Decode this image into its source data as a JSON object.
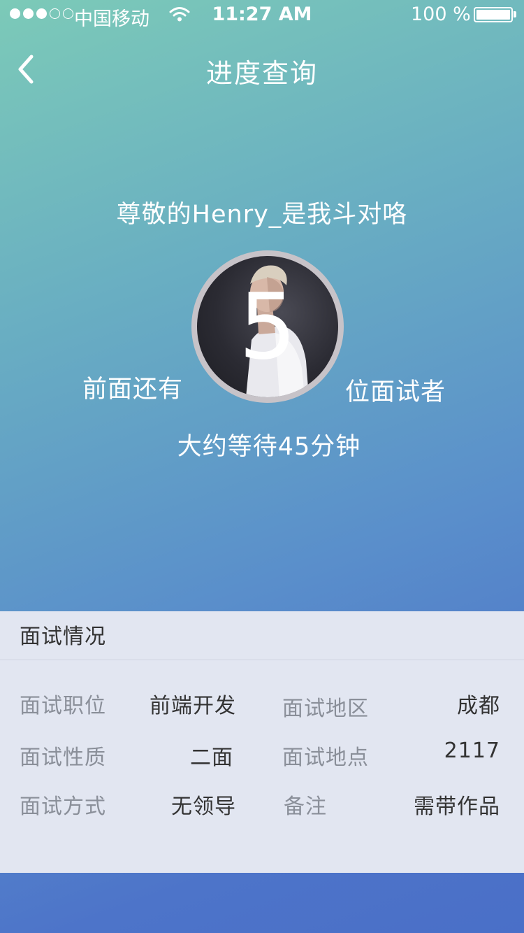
{
  "status_bar": {
    "carrier": "中国移动",
    "time": "11:27 AM",
    "battery": "100 %"
  },
  "nav": {
    "title": "进度查询"
  },
  "greeting": "尊敬的Henry_是我斗对咯",
  "queue": {
    "number": "5",
    "ahead_label": "前面还有",
    "after_label": "位面试者",
    "wait_text": "大约等待45分钟"
  },
  "card": {
    "title": "面试情况",
    "rows": [
      {
        "label1": "面试职位",
        "value1": "前端开发",
        "label2": "面试地区",
        "value2": "成都"
      },
      {
        "label1": "面试性质",
        "value1": "二面",
        "label2": "面试地点",
        "value2": "2117"
      },
      {
        "label1": "面试方式",
        "value1": "无领导",
        "label2": "备注",
        "value2": "需带作品"
      }
    ]
  },
  "colors": {
    "gradient_top": "#7ccab8",
    "gradient_bottom": "#4a6fc8",
    "card_bg": "#e2e6f1"
  },
  "icons": {
    "back": "chevron-left-icon",
    "wifi": "wifi-icon",
    "battery": "battery-icon"
  }
}
